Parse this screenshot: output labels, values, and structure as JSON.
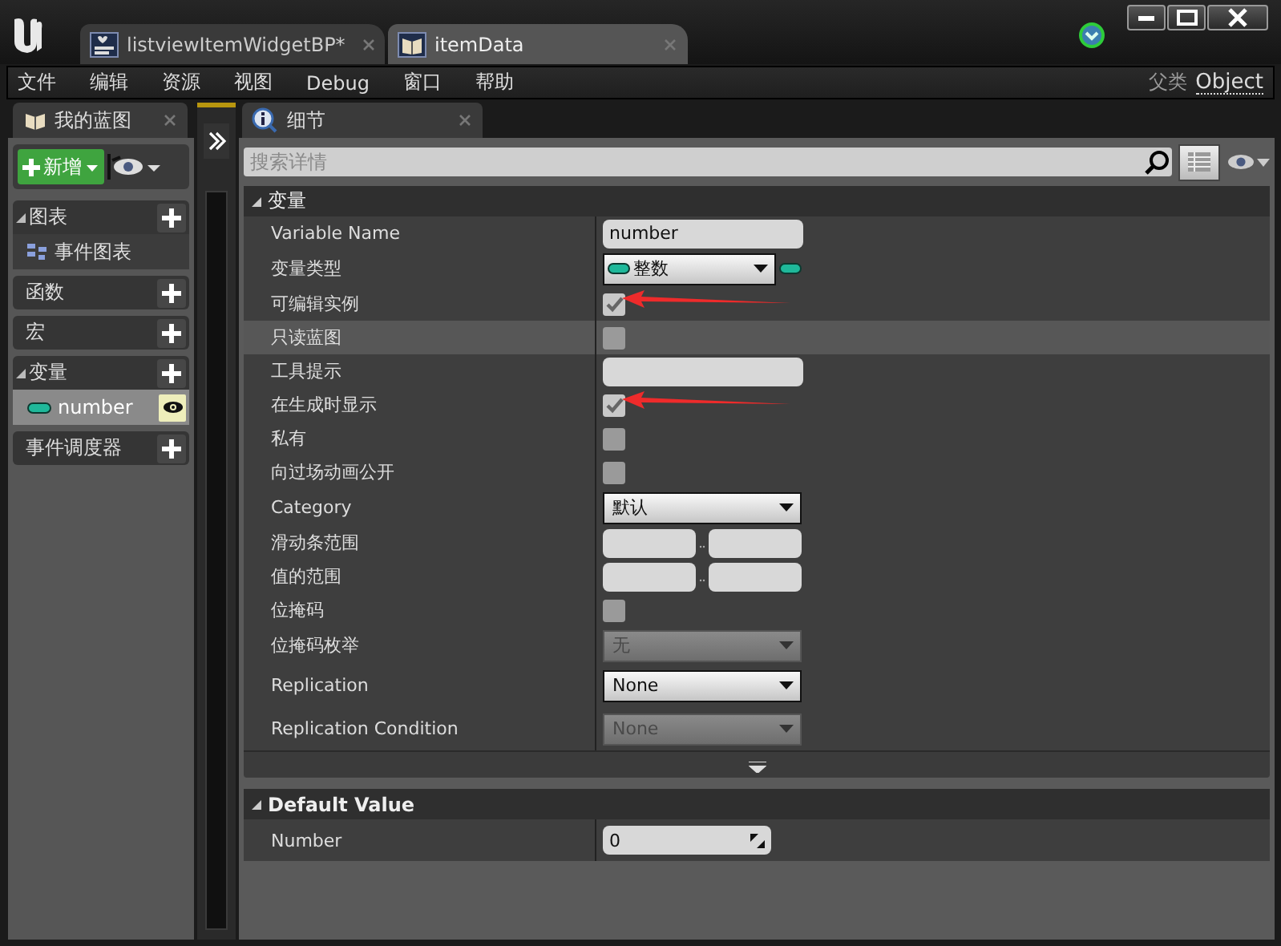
{
  "window": {
    "title_tabs": [
      {
        "label": "listviewItemWidgetBP*",
        "kind": "widget",
        "selected": false
      },
      {
        "label": "itemData",
        "kind": "data",
        "selected": true
      }
    ]
  },
  "menu": [
    "文件",
    "编辑",
    "资源",
    "视图",
    "Debug",
    "窗口",
    "帮助"
  ],
  "parent_class": {
    "label": "父类",
    "value": "Object"
  },
  "my_blueprint": {
    "tab": "我的蓝图",
    "add_button": "新增",
    "sections": [
      {
        "label": "图表",
        "children": [
          {
            "label": "事件图表",
            "kind": "graph",
            "selected": false
          }
        ]
      },
      {
        "label": "函数"
      },
      {
        "label": "宏"
      },
      {
        "label": "变量",
        "children": [
          {
            "label": "number",
            "kind": "variable",
            "selected": true
          }
        ]
      },
      {
        "label": "事件调度器"
      }
    ]
  },
  "details": {
    "tab": "细节",
    "search": {
      "placeholder": "搜索详情"
    },
    "sections": [
      {
        "title": "变量",
        "has_advanced": true,
        "rows": [
          {
            "label": "Variable Name",
            "kind": "text",
            "value": "number",
            "hovered": false
          },
          {
            "label": "变量类型",
            "kind": "type",
            "value": "整数",
            "hovered": false
          },
          {
            "label": "可编辑实例",
            "kind": "checkbox",
            "checked": true,
            "hovered": false,
            "arrow": true
          },
          {
            "label": "只读蓝图",
            "kind": "checkbox",
            "checked": false,
            "hovered": true
          },
          {
            "label": "工具提示",
            "kind": "text",
            "hovered": false
          },
          {
            "label": "在生成时显示",
            "kind": "checkbox",
            "checked": true,
            "hovered": false,
            "arrow": true
          },
          {
            "label": "私有",
            "kind": "checkbox",
            "checked": false,
            "hovered": false
          },
          {
            "label": "向过场动画公开",
            "kind": "checkbox",
            "checked": false,
            "hovered": false
          },
          {
            "label": "Category",
            "kind": "dropdown",
            "value": "默认",
            "disabled": false,
            "hovered": false
          },
          {
            "label": "滑动条范围",
            "kind": "range",
            "hovered": false
          },
          {
            "label": "值的范围",
            "kind": "range",
            "hovered": false
          },
          {
            "label": "位掩码",
            "kind": "checkbox",
            "checked": false,
            "hovered": false
          },
          {
            "label": "位掩码枚举",
            "kind": "dropdown",
            "value": "无",
            "disabled": true,
            "hovered": false
          },
          {
            "label": "Replication",
            "kind": "dropdown",
            "value": "None",
            "disabled": false,
            "hovered": false
          },
          {
            "label": "Replication Condition",
            "kind": "dropdown",
            "value": "None",
            "disabled": true,
            "hovered": false
          }
        ]
      },
      {
        "title": "Default Value",
        "has_advanced": false,
        "rows": [
          {
            "label": "Number",
            "kind": "number",
            "value": "0",
            "hovered": false
          }
        ]
      }
    ]
  }
}
